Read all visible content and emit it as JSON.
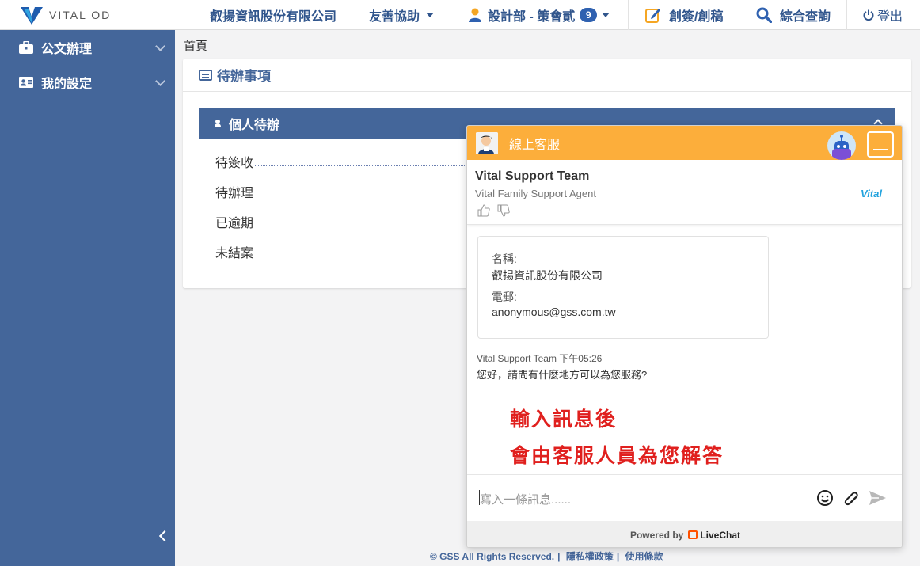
{
  "topbar": {
    "logo_text": "VITAL OD",
    "company": "叡揚資訊股份有限公司",
    "assist": "友善協助",
    "user": "設計部 - 策會貳",
    "user_badge": "9",
    "create": "創簽/創稿",
    "search": "綜合查詢",
    "logout": "登出",
    "icons": {
      "user": "user-icon",
      "create": "edit-icon",
      "search": "search-icon",
      "logout": "power-icon"
    }
  },
  "sidebar": {
    "items": [
      {
        "label": "公文辦理",
        "icon": "briefcase-icon"
      },
      {
        "label": "我的設定",
        "icon": "id-card-icon"
      }
    ]
  },
  "main": {
    "breadcrumb": "首頁",
    "panel_title": "待辦事項",
    "section_title": "個人待辦",
    "todos": [
      "待簽收",
      "待辦理",
      "已逾期",
      "未結案"
    ]
  },
  "footer": {
    "copyright": "© GSS All Rights Reserved.",
    "privacy": "隱私權政策",
    "terms": "使用條款"
  },
  "chat": {
    "header_title": "線上客服",
    "agent_name": "Vital Support Team",
    "agent_role": "Vital Family Support Agent",
    "agent_logo": "Vital",
    "card": {
      "name_label": "名稱:",
      "name_value": "叡揚資訊股份有限公司",
      "email_label": "電郵:",
      "email_value": "anonymous@gss.com.tw"
    },
    "message_meta": "Vital Support Team 下午05:26",
    "message_text": "您好，請問有什麼地方可以為您服務?",
    "notes": [
      "輸入訊息後",
      "會由客服人員為您解答"
    ],
    "input_placeholder": "寫入一條訊息......",
    "powered_by": "Powered by",
    "brand": "LiveChat",
    "colors": {
      "header": "#fcae3b",
      "note": "#e0201e"
    }
  }
}
